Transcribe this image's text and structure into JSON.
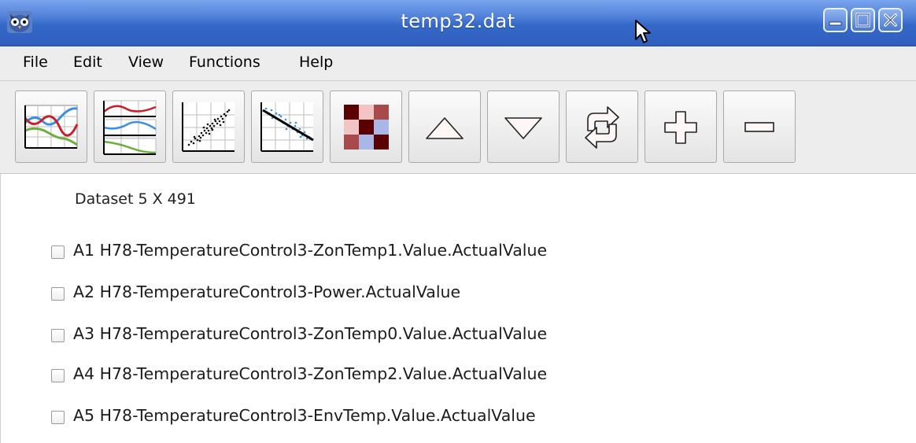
{
  "window": {
    "title": "temp32.dat",
    "controls": [
      "minimize-icon",
      "maximize-icon",
      "close-icon"
    ]
  },
  "menu": {
    "items": [
      "File",
      "Edit",
      "View",
      "Functions",
      "Help"
    ]
  },
  "toolbar": {
    "buttons": [
      {
        "icon": "multi-line-chart-icon"
      },
      {
        "icon": "stacked-line-charts-icon"
      },
      {
        "icon": "scatter-plot-icon"
      },
      {
        "icon": "regression-plot-icon"
      },
      {
        "icon": "correlation-matrix-icon"
      },
      {
        "icon": "move-up-icon"
      },
      {
        "icon": "move-down-icon"
      },
      {
        "icon": "refresh-icon"
      },
      {
        "icon": "add-icon"
      },
      {
        "icon": "remove-icon"
      }
    ]
  },
  "dataset": {
    "label": "Dataset 5 X 491"
  },
  "signals": [
    {
      "id": "A1",
      "label": "A1 H78-TemperatureControl3-ZonTemp1.Value.ActualValue",
      "checked": false
    },
    {
      "id": "A2",
      "label": "A2 H78-TemperatureControl3-Power.ActualValue",
      "checked": false
    },
    {
      "id": "A3",
      "label": "A3 H78-TemperatureControl3-ZonTemp0.Value.ActualValue",
      "checked": false
    },
    {
      "id": "A4",
      "label": "A4 H78-TemperatureControl3-ZonTemp2.Value.ActualValue",
      "checked": false
    },
    {
      "id": "A5",
      "label": "A5 H78-TemperatureControl3-EnvTemp.Value.ActualValue",
      "checked": false
    }
  ],
  "colors": {
    "titlebar": "#3468c8",
    "series_red": "#c8202a",
    "series_blue": "#3a8fe0",
    "series_green": "#6cae3c",
    "matrix_dark": "#5a0000",
    "matrix_mid": "#a84a4a",
    "matrix_light": "#f2c4c4",
    "matrix_blue": "#a9b7e6"
  }
}
